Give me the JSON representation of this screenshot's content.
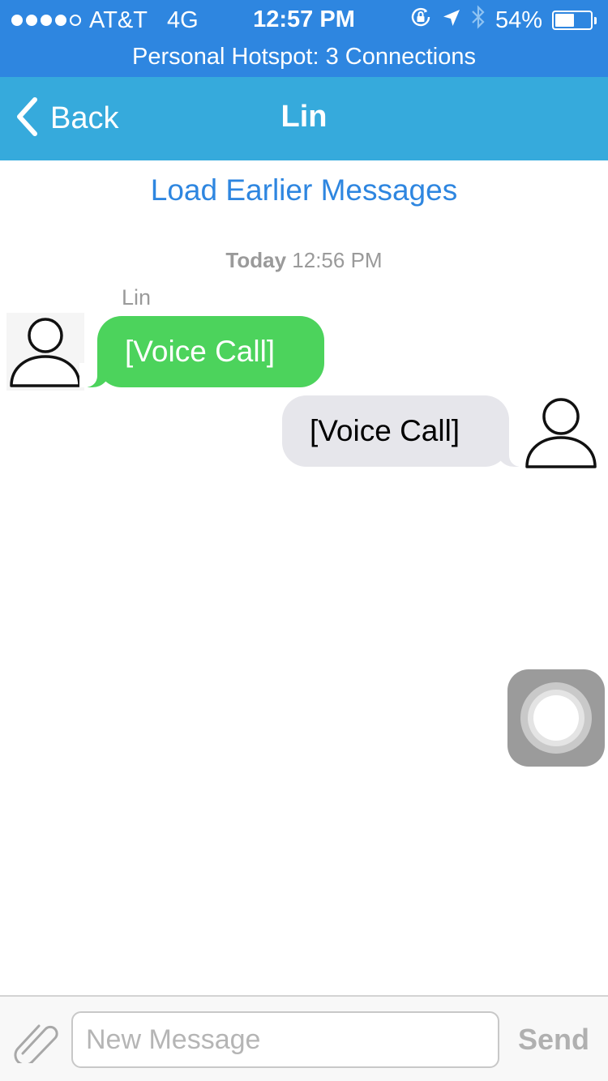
{
  "status_bar": {
    "signal_bars_filled": 4,
    "signal_bars_total": 5,
    "carrier": "AT&T",
    "network": "4G",
    "time": "12:57 PM",
    "battery_percent": "54%",
    "battery_level": 0.54,
    "icons": [
      "lock-rotation-icon",
      "location-arrow-icon",
      "bluetooth-icon",
      "battery-icon"
    ]
  },
  "hotspot_banner": "Personal Hotspot: 3 Connections",
  "nav": {
    "back_label": "Back",
    "title": "Lin"
  },
  "chat": {
    "load_earlier": "Load Earlier Messages",
    "timestamp_day": "Today",
    "timestamp_time": "12:56 PM",
    "messages": [
      {
        "sender": "Lin",
        "direction": "incoming",
        "text": "[Voice Call]"
      },
      {
        "direction": "outgoing",
        "text": "[Voice Call]"
      }
    ]
  },
  "input": {
    "placeholder": "New Message",
    "send_label": "Send"
  },
  "colors": {
    "status_bar_bg": "#2e86e0",
    "nav_bar_bg": "#36aadc",
    "incoming_bubble": "#4cd35c",
    "outgoing_bubble": "#e6e6eb",
    "link": "#2e86e0"
  }
}
